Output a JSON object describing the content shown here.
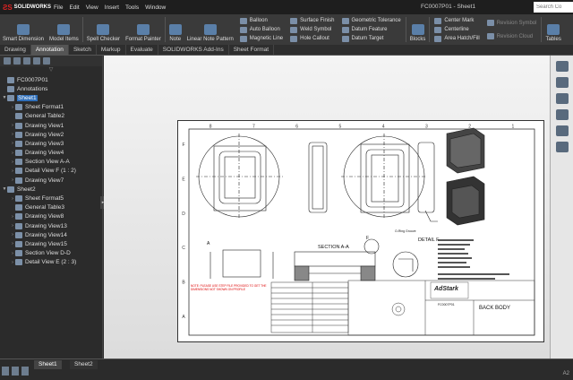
{
  "app": {
    "brand": "SOLIDWORKS",
    "title": "FC0007P01 - Sheet1",
    "search_placeholder": "Search Co"
  },
  "menus": [
    "File",
    "Edit",
    "View",
    "Insert",
    "Tools",
    "Window"
  ],
  "ribbon": {
    "big": [
      {
        "label": "Smart Dimension"
      },
      {
        "label": "Model Items"
      },
      {
        "label": "Spell Checker"
      },
      {
        "label": "Format Painter"
      },
      {
        "label": "Note"
      },
      {
        "label": "Linear Note Pattern"
      }
    ],
    "col1": [
      "Balloon",
      "Auto Balloon",
      "Magnetic Line"
    ],
    "col2": [
      "Surface Finish",
      "Weld Symbol",
      "Hole Callout"
    ],
    "col3": [
      "Geometric Tolerance",
      "Datum Feature",
      "Datum Target"
    ],
    "blocks": "Blocks",
    "col4": [
      "Center Mark",
      "Centerline",
      "Area Hatch/Fill"
    ],
    "col5": [
      "Revision Symbol",
      "Revision Cloud"
    ],
    "tables": "Tables"
  },
  "tabs": [
    "Drawing",
    "Annotation",
    "Sketch",
    "Markup",
    "Evaluate",
    "SOLIDWORKS Add-Ins",
    "Sheet Format"
  ],
  "active_tab": "Annotation",
  "tree": [
    {
      "label": "FC0007P01",
      "lvl": 0,
      "tw": ""
    },
    {
      "label": "Annotations",
      "lvl": 0,
      "tw": ""
    },
    {
      "label": "Sheet1",
      "lvl": 0,
      "tw": "▼",
      "sel": true
    },
    {
      "label": "Sheet Format1",
      "lvl": 1,
      "tw": "›"
    },
    {
      "label": "General Table2",
      "lvl": 1,
      "tw": ""
    },
    {
      "label": "Drawing View1",
      "lvl": 1,
      "tw": "›"
    },
    {
      "label": "Drawing View2",
      "lvl": 1,
      "tw": "›"
    },
    {
      "label": "Drawing View3",
      "lvl": 1,
      "tw": "›"
    },
    {
      "label": "Drawing View4",
      "lvl": 1,
      "tw": "›"
    },
    {
      "label": "Section View A-A",
      "lvl": 1,
      "tw": "›"
    },
    {
      "label": "Detail View F (1 : 2)",
      "lvl": 1,
      "tw": "›"
    },
    {
      "label": "Drawing View7",
      "lvl": 1,
      "tw": "›"
    },
    {
      "label": "Sheet2",
      "lvl": 0,
      "tw": "▼"
    },
    {
      "label": "Sheet Format5",
      "lvl": 1,
      "tw": "›"
    },
    {
      "label": "General Table3",
      "lvl": 1,
      "tw": ""
    },
    {
      "label": "Drawing View8",
      "lvl": 1,
      "tw": "›"
    },
    {
      "label": "Drawing View13",
      "lvl": 1,
      "tw": "›"
    },
    {
      "label": "Drawing View14",
      "lvl": 1,
      "tw": "›"
    },
    {
      "label": "Drawing View15",
      "lvl": 1,
      "tw": "›"
    },
    {
      "label": "Section View D-D",
      "lvl": 1,
      "tw": "›"
    },
    {
      "label": "Detail View E (2 : 3)",
      "lvl": 1,
      "tw": "›"
    }
  ],
  "drawing": {
    "section_label": "SECTION A-A",
    "detail_label": "DETAIL F",
    "title": "BACK BODY",
    "company": "AdStark",
    "part_no": "FC0007P01",
    "col_nums": [
      "8",
      "7",
      "6",
      "5",
      "4",
      "3",
      "2",
      "1"
    ],
    "row_letters": [
      "F",
      "E",
      "D",
      "C",
      "B",
      "A"
    ],
    "red_note": "NOTE: PLEASE USE STEP FILE PROVIDED TO GET THE DIMENSIONS NOT SHOWN ON PROFILE",
    "callout": "O-Ring Groove",
    "label_a": "A",
    "label_f": "F"
  },
  "sheet_tabs": [
    "Sheet1",
    "Sheet2"
  ],
  "status": "A2"
}
